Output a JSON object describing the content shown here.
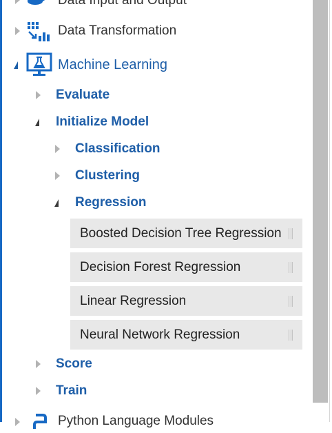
{
  "tree": {
    "data_input_output": {
      "label": "Data Input and Output",
      "icon": "database-icon"
    },
    "data_transformation": {
      "label": "Data Transformation",
      "icon": "grid-chart-icon"
    },
    "machine_learning": {
      "label": "Machine Learning",
      "icon": "flask-monitor-icon",
      "children": {
        "evaluate": {
          "label": "Evaluate"
        },
        "initialize_model": {
          "label": "Initialize Model",
          "children": {
            "classification": {
              "label": "Classification"
            },
            "clustering": {
              "label": "Clustering"
            },
            "regression": {
              "label": "Regression",
              "modules": [
                {
                  "label": "Boosted Decision Tree Regression"
                },
                {
                  "label": "Decision Forest Regression"
                },
                {
                  "label": "Linear Regression"
                },
                {
                  "label": "Neural Network Regression"
                }
              ]
            }
          }
        },
        "score": {
          "label": "Score"
        },
        "train": {
          "label": "Train"
        }
      }
    },
    "python_modules": {
      "label": "Python Language Modules",
      "icon": "python-icon"
    }
  },
  "colors": {
    "accent": "#1e5ea8",
    "selection_bar": "#1769c4",
    "module_bg": "#e8e8e8",
    "scrollbar": "#bdbdbd"
  }
}
